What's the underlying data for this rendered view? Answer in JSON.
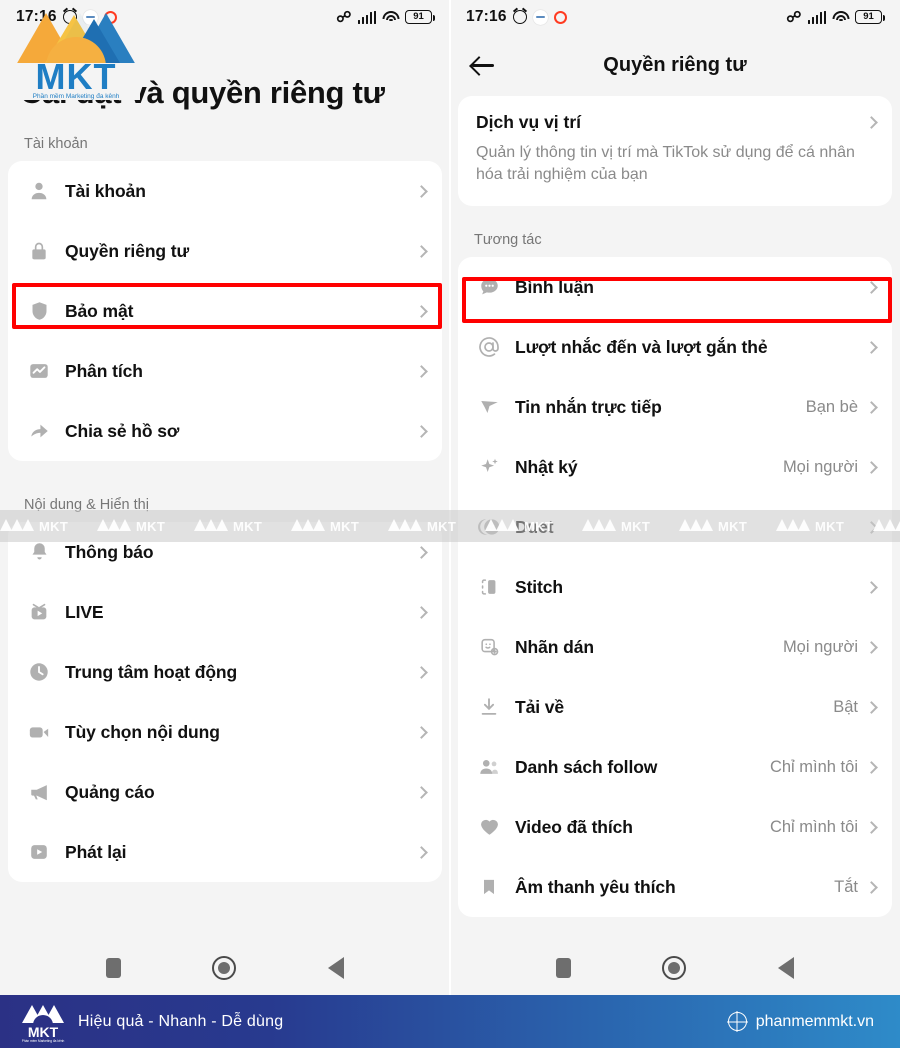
{
  "left": {
    "statusbar": {
      "time": "17:16",
      "battery": "91",
      "icons": [
        "alarm-icon",
        "badge-icon",
        "ring-icon",
        "bluetooth-icon",
        "signal-icon",
        "wifi-icon",
        "battery-icon"
      ]
    },
    "page_title": "Cài đặt và quyền riêng tư",
    "sections": [
      {
        "label": "Tài khoản",
        "items": [
          {
            "icon": "person-icon",
            "label": "Tài khoản",
            "value": "",
            "highlighted": false
          },
          {
            "icon": "lock-icon",
            "label": "Quyền riêng tư",
            "value": "",
            "highlighted": true
          },
          {
            "icon": "shield-icon",
            "label": "Bảo mật",
            "value": "",
            "highlighted": false
          },
          {
            "icon": "chart-icon",
            "label": "Phân tích",
            "value": "",
            "highlighted": false
          },
          {
            "icon": "share-icon",
            "label": "Chia sẻ hồ sơ",
            "value": "",
            "highlighted": false
          }
        ]
      },
      {
        "label": "Nội dung & Hiển thị",
        "items": [
          {
            "icon": "bell-icon",
            "label": "Thông báo",
            "value": "",
            "highlighted": false
          },
          {
            "icon": "live-tv-icon",
            "label": "LIVE",
            "value": "",
            "highlighted": false
          },
          {
            "icon": "clock-icon",
            "label": "Trung tâm hoạt động",
            "value": "",
            "highlighted": false
          },
          {
            "icon": "video-cam-icon",
            "label": "Tùy chọn nội dung",
            "value": "",
            "highlighted": false
          },
          {
            "icon": "megaphone-icon",
            "label": "Quảng cáo",
            "value": "",
            "highlighted": false
          },
          {
            "icon": "play-icon",
            "label": "Phát lại",
            "value": "",
            "highlighted": false
          }
        ]
      }
    ]
  },
  "right": {
    "statusbar": {
      "time": "17:16",
      "battery": "91"
    },
    "appbar_title": "Quyền riêng tư",
    "location": {
      "title": "Dịch vụ vị trí",
      "description": "Quản lý thông tin vị trí mà TikTok sử dụng để cá nhân hóa trải nghiệm của bạn"
    },
    "section_label": "Tương tác",
    "items": [
      {
        "icon": "comment-icon",
        "label": "Bình luận",
        "value": "",
        "highlighted": true
      },
      {
        "icon": "at-mention-icon",
        "label": "Lượt nhắc đến và lượt gắn thẻ",
        "value": "",
        "highlighted": false
      },
      {
        "icon": "paper-plane-icon",
        "label": "Tin nhắn trực tiếp",
        "value": "Bạn bè",
        "highlighted": false
      },
      {
        "icon": "sparkle-icon",
        "label": "Nhật ký",
        "value": "Mọi người",
        "highlighted": false
      },
      {
        "icon": "duet-icon",
        "label": "Duet",
        "value": "",
        "highlighted": false
      },
      {
        "icon": "stitch-icon",
        "label": "Stitch",
        "value": "",
        "highlighted": false
      },
      {
        "icon": "sticker-icon",
        "label": "Nhãn dán",
        "value": "Mọi người",
        "highlighted": false
      },
      {
        "icon": "download-icon",
        "label": "Tải về",
        "value": "Bật",
        "highlighted": false
      },
      {
        "icon": "follow-list-icon",
        "label": "Danh sách follow",
        "value": "Chỉ mình tôi",
        "highlighted": false
      },
      {
        "icon": "heart-icon",
        "label": "Video đã thích",
        "value": "Chỉ mình tôi",
        "highlighted": false
      },
      {
        "icon": "bookmark-icon",
        "label": "Âm thanh yêu thích",
        "value": "Tắt",
        "highlighted": false
      }
    ]
  },
  "watermark": {
    "text": "MKT",
    "repeat": 10
  },
  "navbar": {
    "buttons": [
      "recents-square-button",
      "home-circle-button",
      "back-triangle-button"
    ]
  },
  "footer": {
    "tagline": "Hiệu quả - Nhanh - Dễ dùng",
    "url": "phanmemmkt.vn",
    "logo_text": "MKT",
    "logo_sub": "Phần mềm Marketing đa kênh",
    "gradient_from": "#2b3185",
    "gradient_to": "#2e8bc9"
  },
  "accent": {
    "highlight_red": "#ff0000",
    "brand_blue": "#1f7ec4",
    "brand_orange": "#f2a33c"
  }
}
